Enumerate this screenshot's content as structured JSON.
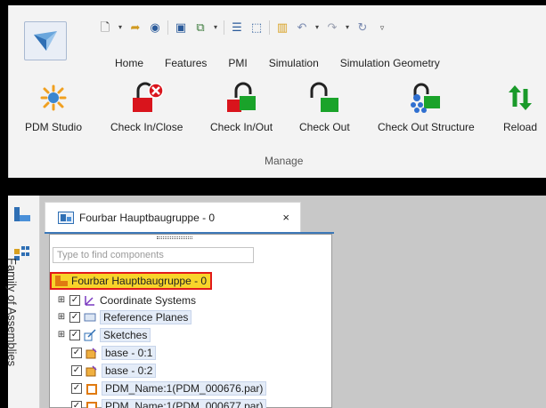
{
  "ribbon": {
    "tabs": [
      "Home",
      "Features",
      "PMI",
      "Simulation",
      "Simulation Geometry"
    ],
    "manage_group": {
      "label": "Manage",
      "tools": [
        "PDM Studio",
        "Check In/Close",
        "Check In/Out",
        "Check Out",
        "Check Out Structure",
        "Reload"
      ]
    }
  },
  "side": {
    "vertical_label": "Family of Assemblies"
  },
  "document": {
    "tab_label": "Fourbar Hauptbaugruppe - 0",
    "close": "×"
  },
  "tree": {
    "search_placeholder": "Type to find components",
    "root": "Fourbar Hauptbaugruppe - 0",
    "items": [
      "Coordinate Systems",
      "Reference Planes",
      "Sketches",
      "base - 0:1",
      "base - 0:2",
      "PDM_Name:1(PDM_000676.par)",
      "PDM_Name:1(PDM_000677.par)"
    ]
  },
  "colors": {
    "ribbon_bg": "#f3f3f3",
    "accent_blue": "#3c78b8",
    "root_highlight": "#f8d42a",
    "root_border": "#e21a1a",
    "lock_red": "#d9141c",
    "lock_green": "#1aa32a"
  }
}
